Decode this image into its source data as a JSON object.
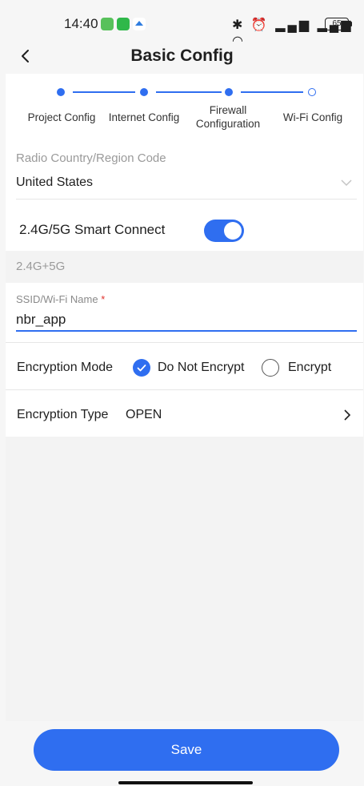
{
  "status_bar": {
    "time": "14:40",
    "icons": "✱ ⏰ ▂▄▆ ▂▄▆ ◠",
    "battery": "65"
  },
  "header": {
    "title": "Basic Config"
  },
  "steps": [
    {
      "label": "Project Config",
      "state": "done"
    },
    {
      "label": "Internet Config",
      "state": "done"
    },
    {
      "label": "Firewall Configuration",
      "state": "current"
    },
    {
      "label": "Wi-Fi Config",
      "state": "pending"
    }
  ],
  "form": {
    "region_label": "Radio Country/Region Code",
    "region_value": "United States",
    "smart_connect_label": "2.4G/5G Smart Connect",
    "smart_connect_on": true,
    "band_text": "2.4G+5G",
    "ssid_label": "SSID/Wi-Fi Name",
    "ssid_required_mark": "*",
    "ssid_value": "nbr_app",
    "encryption_mode_label": "Encryption Mode",
    "encryption_options": [
      "Do Not Encrypt",
      "Encrypt"
    ],
    "encryption_selected": "Do Not Encrypt",
    "encryption_type_label": "Encryption Type",
    "encryption_type_value": "OPEN"
  },
  "footer": {
    "save_label": "Save"
  },
  "colors": {
    "accent": "#2f6ef0",
    "required": "#e0322e",
    "background": "#f6f6f6"
  }
}
